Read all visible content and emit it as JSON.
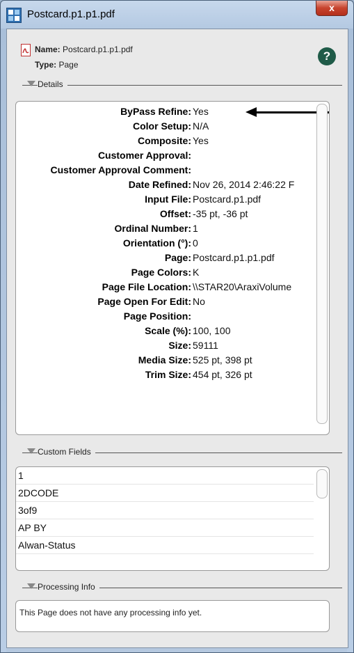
{
  "window": {
    "title": "Postcard.p1.p1.pdf",
    "close_label": "x",
    "title_icon": "app-grid-icon"
  },
  "header": {
    "name_label": "Name:",
    "name_value": "Postcard.p1.p1.pdf",
    "type_label": "Type:",
    "type_value": "Page",
    "file_icon": "pdf-file-icon",
    "help_label": "?"
  },
  "sections": {
    "details": "Details",
    "custom_fields": "Custom Fields",
    "processing_info": "Processing Info"
  },
  "details": [
    {
      "key": "ByPass Refine",
      "value": "Yes"
    },
    {
      "key": "Color Setup",
      "value": "N/A"
    },
    {
      "key": "Composite",
      "value": "Yes"
    },
    {
      "key": "Customer Approval",
      "value": ""
    },
    {
      "key": "Customer Approval Comment",
      "value": ""
    },
    {
      "key": "Date Refined",
      "value": "Nov 26, 2014 2:46:22 F"
    },
    {
      "key": "Input File",
      "value": "Postcard.p1.pdf"
    },
    {
      "key": "Offset",
      "value": "-35 pt, -36 pt"
    },
    {
      "key": "Ordinal Number",
      "value": "1"
    },
    {
      "key": "Orientation (°)",
      "value": "0"
    },
    {
      "key": "Page",
      "value": "Postcard.p1.p1.pdf"
    },
    {
      "key": "Page Colors",
      "value": "K"
    },
    {
      "key": "Page File Location",
      "value": "\\\\STAR20\\AraxiVolume"
    },
    {
      "key": "Page Open For Edit",
      "value": "No"
    },
    {
      "key": "Page Position",
      "value": ""
    },
    {
      "key": "Scale (%)",
      "value": "100, 100"
    },
    {
      "key": "Size",
      "value": "59111"
    },
    {
      "key": "Media Size",
      "value": "525 pt, 398 pt"
    },
    {
      "key": "Trim Size",
      "value": "454 pt, 326 pt"
    }
  ],
  "custom_fields": [
    "1",
    "2DCODE",
    "3of9",
    "AP BY",
    "Alwan-Status"
  ],
  "processing_info": {
    "text": "This Page does not have any processing info yet."
  },
  "colors": {
    "help_button": "#1f5b48",
    "close_button": "#c7432d",
    "arrow": "#000000"
  }
}
